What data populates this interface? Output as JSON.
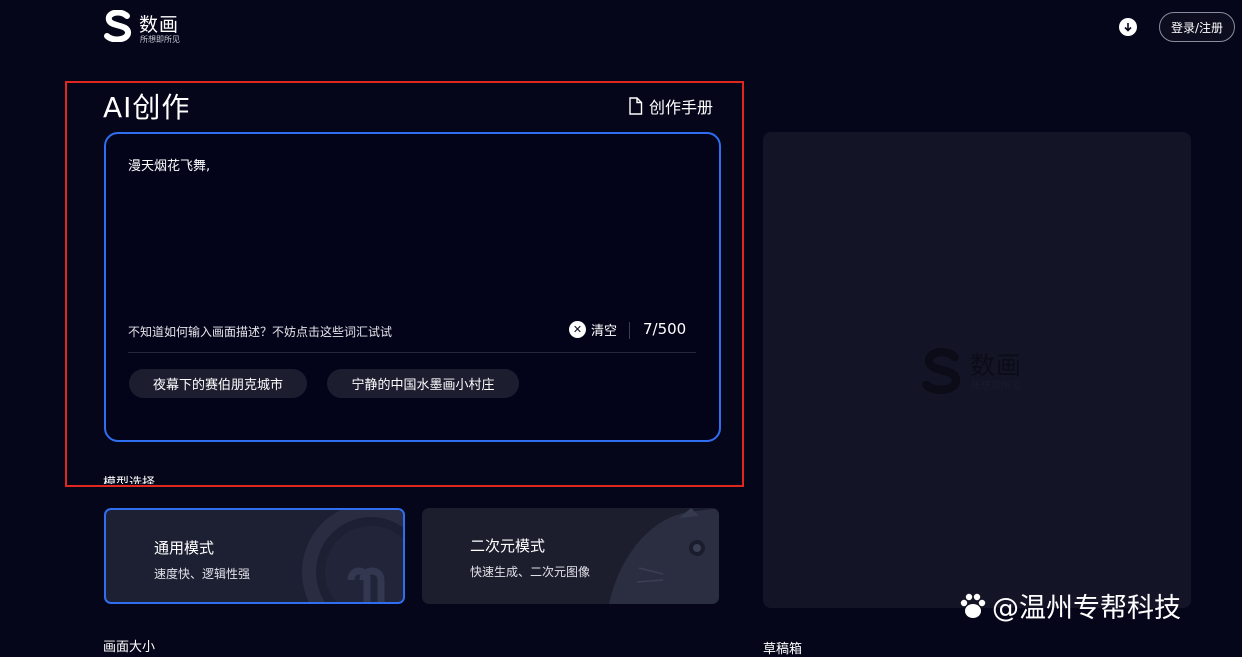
{
  "header": {
    "brand_name": "数画",
    "brand_tagline": "所想即所见",
    "download_icon": "download-icon",
    "login_label": "登录/注册"
  },
  "creation": {
    "title": "AI创作",
    "manual_label": "创作手册",
    "manual_icon": "document-icon",
    "prompt_value": "漫天烟花飞舞,",
    "hint": "不知道如何输入画面描述？不妨点击这些词汇试试",
    "clear_label": "清空",
    "counter": "7/500",
    "suggestions": [
      "夜幕下的赛伯朋克城市",
      "宁静的中国水墨画小村庄"
    ]
  },
  "model": {
    "section_label": "模型选择",
    "options": [
      {
        "title": "通用模式",
        "desc": "速度快、逻辑性强",
        "selected": true
      },
      {
        "title": "二次元模式",
        "desc": "快速生成、二次元图像",
        "selected": false
      }
    ]
  },
  "size": {
    "section_label": "画面大小"
  },
  "preview": {
    "watermark_name": "数画",
    "watermark_tagline": "所想即所见",
    "draft_label": "草稿箱"
  },
  "credit": "@温州专帮科技",
  "colors": {
    "background": "#05061a",
    "accent": "#2f6ef0",
    "annotation": "#e0271f"
  }
}
